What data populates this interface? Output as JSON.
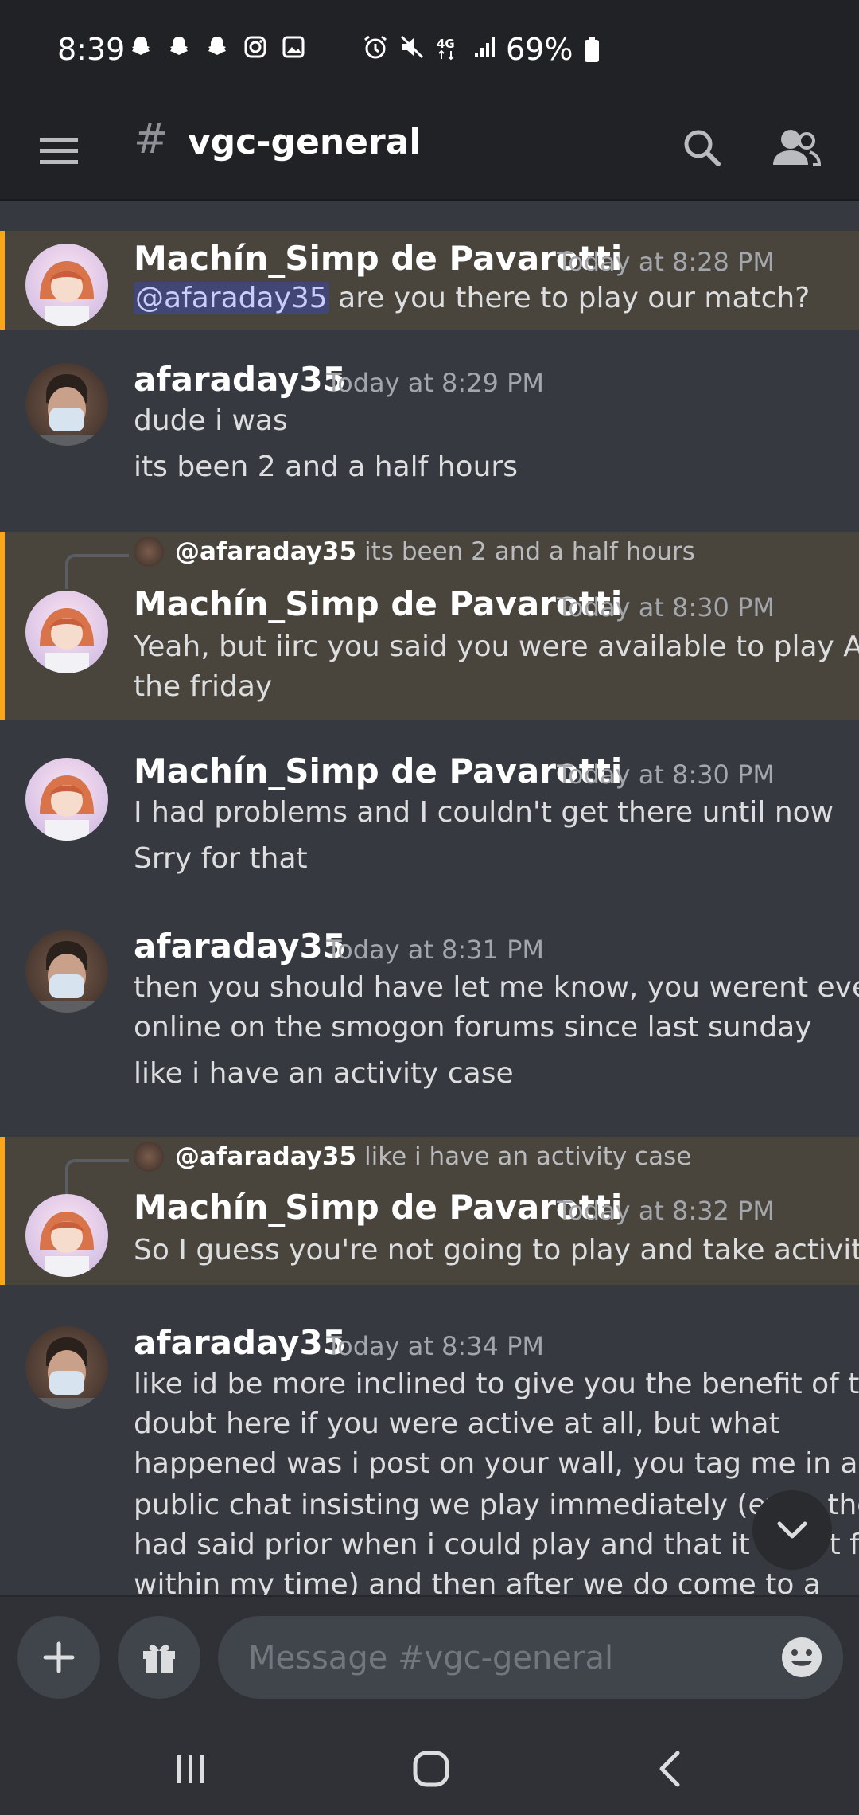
{
  "status_bar": {
    "time": "8:39",
    "battery": "69%",
    "left_icons": [
      "snapchat-icon",
      "snapchat-icon",
      "snapchat-icon",
      "instagram-icon",
      "gallery-icon"
    ],
    "right_icons": [
      "alarm-icon",
      "mute-icon",
      "4g-lte-icon",
      "signal-icon",
      "battery-icon"
    ]
  },
  "header": {
    "hash": "#",
    "channel": "vgc-general"
  },
  "messages": [
    {
      "author": "Machín_Simp de Pavarotti",
      "time": "Today at 8:28 PM",
      "mention": "@afaraday35",
      "text_after_mention": " are you there to play our match?"
    },
    {
      "author": "afaraday35",
      "time": "Today at 8:29 PM",
      "lines": [
        "dude i was",
        "its been 2 and a half hours"
      ]
    },
    {
      "reply_name": "@afaraday35",
      "reply_text": "its been 2 and a half hours",
      "author": "Machín_Simp de Pavarotti",
      "time": "Today at 8:30 PM",
      "lines": [
        "Yeah, but iirc you said you were available to play All",
        "the friday"
      ]
    },
    {
      "author": "Machín_Simp de Pavarotti",
      "time": "Today at 8:30 PM",
      "lines": [
        "I had problems and I couldn't get there until now",
        "Srry for that"
      ]
    },
    {
      "author": "afaraday35",
      "time": "Today at 8:31 PM",
      "lines": [
        "then you should have let me know, you werent even",
        "online on the smogon forums since last sunday",
        "like i have an activity case"
      ]
    },
    {
      "reply_name": "@afaraday35",
      "reply_text": "like i have an activity case",
      "author": "Machín_Simp de Pavarotti",
      "time": "Today at 8:32 PM",
      "lines": [
        "So I guess you're not going to play and take activity"
      ]
    },
    {
      "author": "afaraday35",
      "time": "Today at 8:34 PM",
      "lines": [
        "like id be more inclined to give you the benefit of the",
        "doubt here if you were active at all, but what",
        "happened was i post on your wall, you tag me in a",
        "public chat insisting we play immediately (even tho i",
        "had said prior when i could play and that it didn't fit",
        "within my time) and then after we do come to a"
      ]
    }
  ],
  "composer": {
    "placeholder": "Message #vgc-general"
  }
}
